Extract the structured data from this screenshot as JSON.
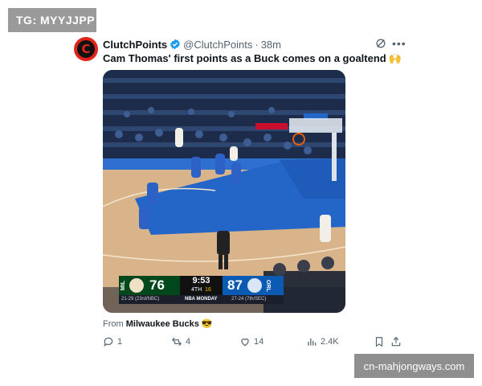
{
  "watermarks": {
    "telegram": "TG: MYYJJPP",
    "site": "cn-mahjongways.com"
  },
  "tweet": {
    "author_name": "ClutchPoints",
    "author_handle": "@ClutchPoints",
    "separator": "·",
    "time": "38m",
    "text": "Cam Thomas' first points as a Buck comes on a goaltend",
    "text_emoji": "🙌",
    "from_prefix": "From",
    "from_source": "Milwaukee Bucks",
    "from_emoji": "😎",
    "actions": {
      "replies": "1",
      "reposts": "4",
      "likes": "14",
      "views": "2.4K"
    }
  },
  "scorebug": {
    "home_abbr": "MIL",
    "home_score": "76",
    "home_record": "21-29 (23rd/NBC)",
    "clock": "9:53",
    "quarter": "4TH",
    "shot_clock": "16",
    "network": "NBA MONDAY",
    "away_score": "87",
    "away_abbr": "ORL",
    "away_record": "27-24 (7th/SEC)"
  },
  "colors": {
    "verified": "#1d9bf0",
    "brand": "#e1251b",
    "bucks_green": "#00471b",
    "magic_blue": "#0b5bb5"
  }
}
